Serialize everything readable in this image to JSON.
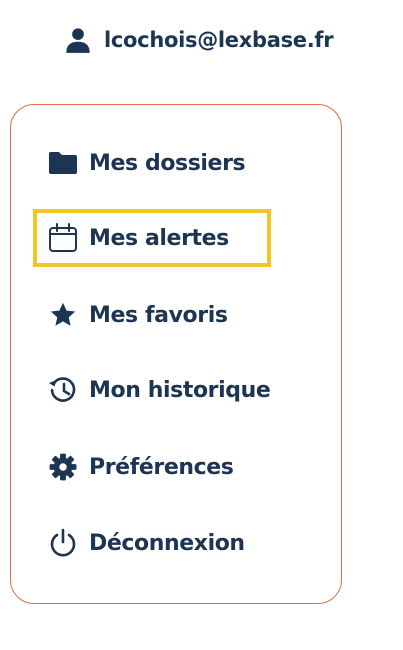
{
  "user": {
    "email": "lcochois@lexbase.fr",
    "icon": "user-icon"
  },
  "menu": {
    "items": [
      {
        "label": "Mes dossiers",
        "icon": "folder-icon"
      },
      {
        "label": "Mes alertes",
        "icon": "calendar-icon",
        "focused": true
      },
      {
        "label": "Mes favoris",
        "icon": "star-icon"
      },
      {
        "label": "Mon historique",
        "icon": "history-icon"
      },
      {
        "label": "Préférences",
        "icon": "gear-icon"
      },
      {
        "label": "Déconnexion",
        "icon": "power-icon"
      }
    ]
  },
  "colors": {
    "text": "#1b3553",
    "card_border": "#e06a4a",
    "focus_outline": "#f3c623"
  }
}
